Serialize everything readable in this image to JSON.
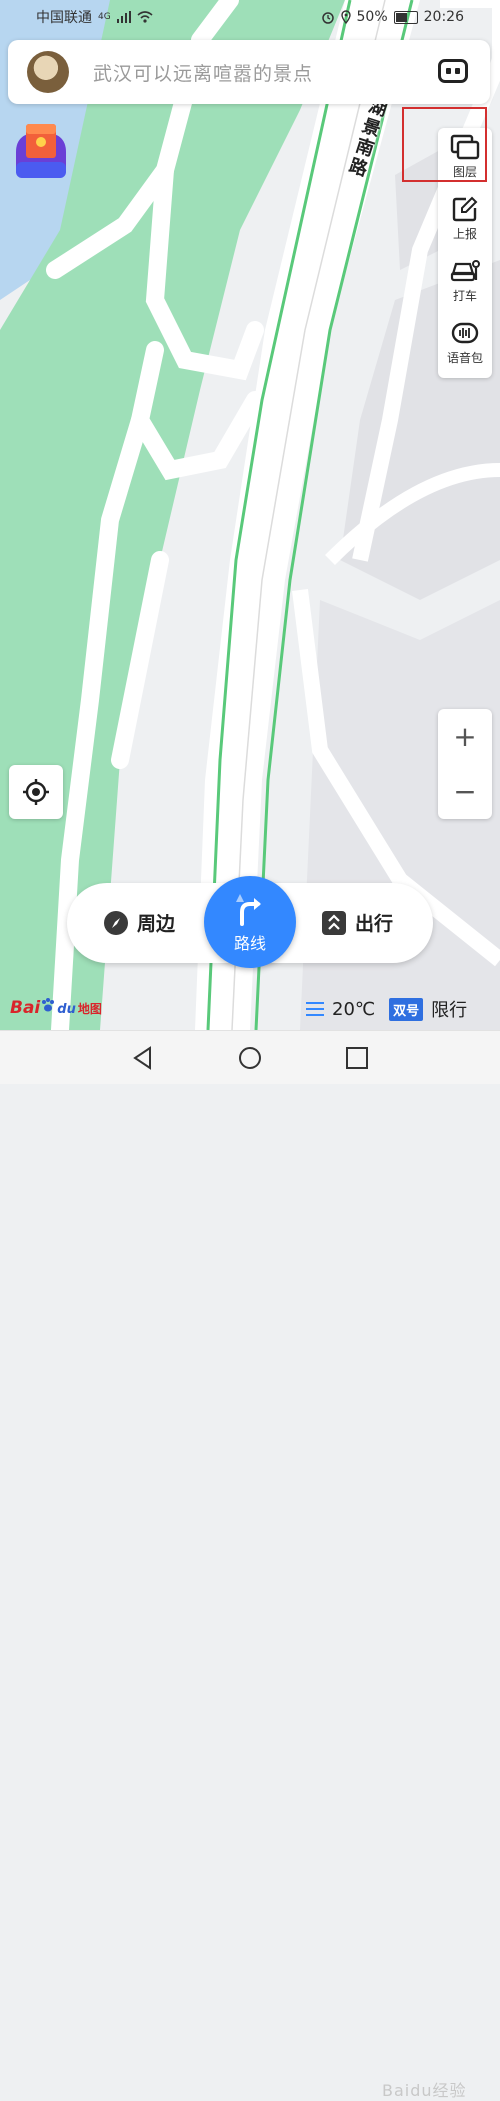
{
  "status_bar": {
    "carrier": "中国联通",
    "network": "4G",
    "battery_text": "50%",
    "battery_level": 0.5,
    "time": "20:26",
    "icons": [
      "signal-icon",
      "wifi-icon",
      "alarm-icon",
      "location-icon",
      "battery-icon"
    ]
  },
  "search": {
    "placeholder": "武汉可以远离喧嚣的景点",
    "voice_icon": "voice-assistant-icon"
  },
  "map": {
    "road_name": "湖景南路",
    "colors": {
      "green_space": "#9edfb8",
      "water": "#b7d6f0",
      "land": "#eef0f2",
      "road": "#ffffff",
      "road_edge": "#59c97a"
    }
  },
  "toolbar": {
    "layers_label": "图层",
    "report_label": "上报",
    "taxi_label": "打车",
    "voice_pack_label": "语音包",
    "highlight_color": "#d32f2f"
  },
  "zoom": {
    "in_label": "+",
    "out_label": "−"
  },
  "bottom": {
    "nearby_label": "周边",
    "route_label": "路线",
    "outing_label": "出行",
    "accent": "#3388ff"
  },
  "footer": {
    "logo_bai": "Bai",
    "logo_du": "du",
    "logo_map": "地图",
    "temperature": "20℃",
    "plate_label": "双号",
    "restriction_label": "限行"
  },
  "watermark": "Baidu经验"
}
